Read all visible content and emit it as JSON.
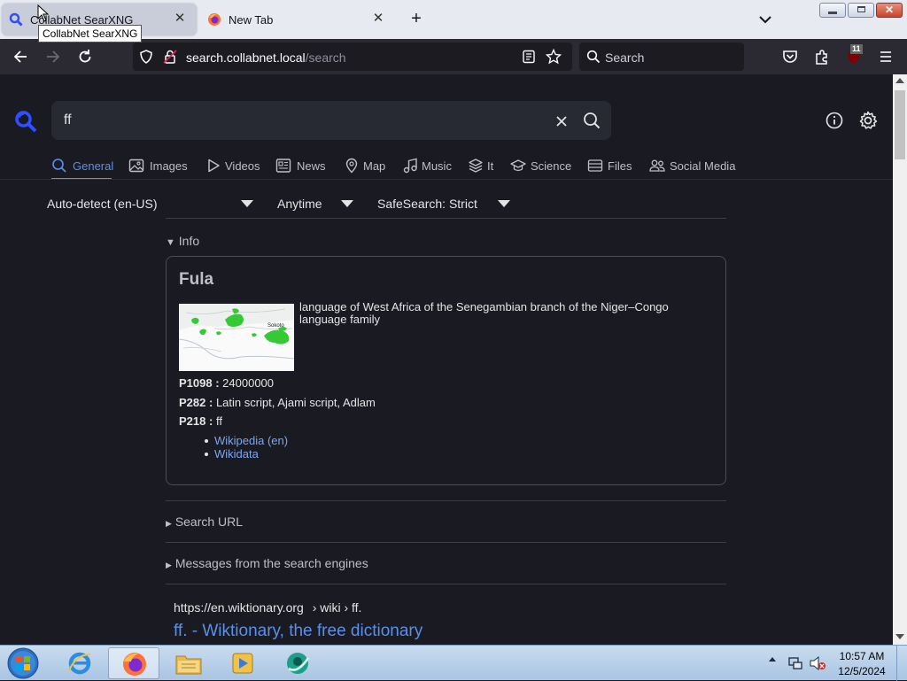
{
  "browser": {
    "tabs": [
      {
        "title": "CollabNet SearXNG",
        "active": true
      },
      {
        "title": "New Tab",
        "active": false
      }
    ],
    "tooltip": "CollabNet SearXNG",
    "url_domain": "search.collabnet.local",
    "url_path": "/search",
    "search_placeholder": "Search",
    "extension_badge": "11"
  },
  "search": {
    "query": "ff"
  },
  "categories": [
    {
      "label": "General",
      "icon": "search-icon",
      "active": true
    },
    {
      "label": "Images",
      "icon": "image-icon"
    },
    {
      "label": "Videos",
      "icon": "play-icon"
    },
    {
      "label": "News",
      "icon": "newspaper-icon"
    },
    {
      "label": "Map",
      "icon": "map-pin-icon"
    },
    {
      "label": "Music",
      "icon": "music-note-icon"
    },
    {
      "label": "It",
      "icon": "layers-icon"
    },
    {
      "label": "Science",
      "icon": "school-icon"
    },
    {
      "label": "Files",
      "icon": "file-tray-icon"
    },
    {
      "label": "Social Media",
      "icon": "people-icon"
    }
  ],
  "filters": {
    "language": "Auto-detect (en-US)",
    "time": "Anytime",
    "safesearch": "SafeSearch: Strict"
  },
  "info": {
    "section_label": "Info",
    "title": "Fula",
    "description": "language of West Africa of the Senegambian branch of the Niger–Congo language family",
    "map_label": "Sokoto",
    "attributes": [
      {
        "key": "P1098 :",
        "value": "24000000"
      },
      {
        "key": "P282 :",
        "value": "Latin script, Ajami script, Adlam"
      },
      {
        "key": "P218 :",
        "value": "ff"
      }
    ],
    "links": [
      "Wikipedia (en)",
      "Wikidata"
    ]
  },
  "sections": {
    "search_url": "Search URL",
    "messages": "Messages from the search engines"
  },
  "result": {
    "url": "https://en.wiktionary.org",
    "breadcrumb": "› wiki › ff.",
    "title": "ff. - Wiktionary, the free dictionary"
  },
  "taskbar": {
    "time": "10:57 AM",
    "date": "12/5/2024"
  },
  "colors": {
    "accent": "#5c8fe6",
    "link": "#7aa6f0",
    "page_bg": "#1a1b22",
    "logo_blue": "#3050ff"
  }
}
